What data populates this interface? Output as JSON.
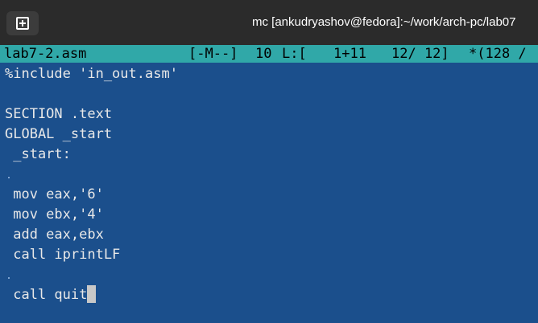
{
  "window": {
    "title": "mc [ankudryashov@fedora]:~/work/arch-pc/lab07",
    "new_tab_icon": "plus-square-icon"
  },
  "status": {
    "filename": "lab7-2.asm",
    "mode": "[-M--]",
    "column": "10",
    "line_label": "L:[",
    "line_pos": "1+11",
    "line_count": "12/ 12]",
    "char_info": "*(128 /"
  },
  "editor": {
    "lines": [
      "%include 'in_out.asm'",
      "",
      "SECTION .text",
      "GLOBAL _start",
      " _start:",
      "",
      " mov eax,'6'",
      " mov ebx,'4'",
      " add eax,ebx",
      " call iprintLF",
      "",
      " call quit"
    ]
  },
  "colors": {
    "titlebar": "#2b2b2b",
    "statusbar": "#30a8a8",
    "editor_bg": "#1b4f8c",
    "editor_text": "#e8e8e8"
  }
}
